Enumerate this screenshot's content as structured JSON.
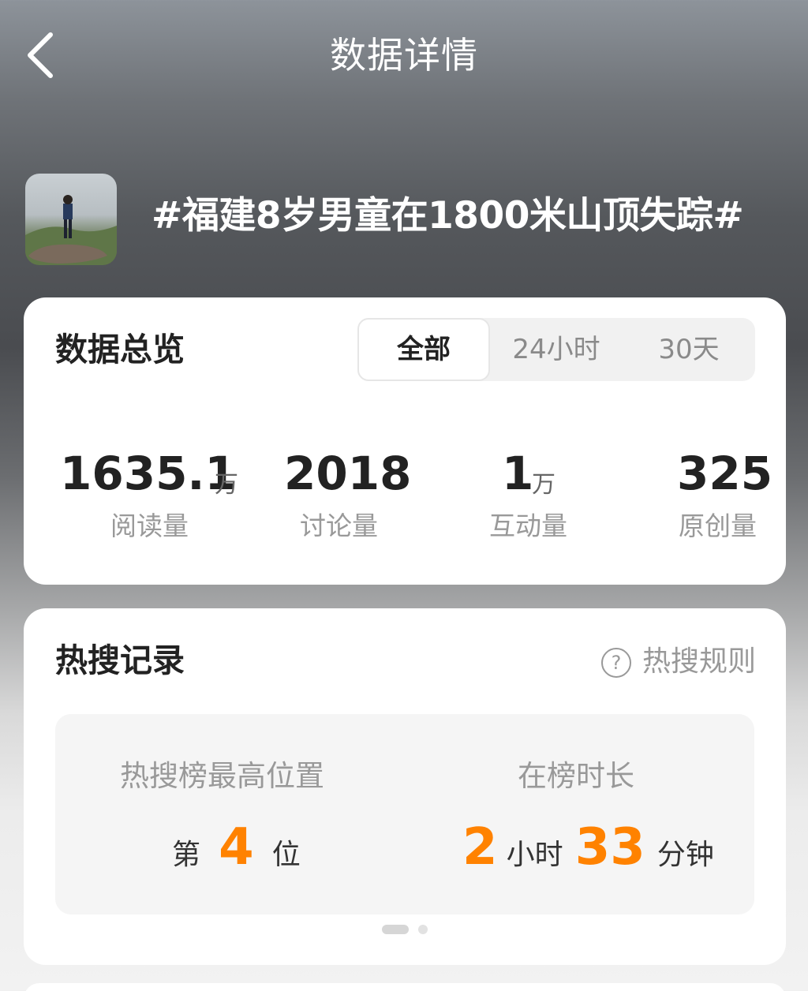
{
  "header": {
    "title": "数据详情"
  },
  "topic": {
    "title": "#福建8岁男童在1800米山顶失踪#"
  },
  "overview": {
    "heading": "数据总览",
    "tabs": [
      {
        "label": "全部",
        "active": true
      },
      {
        "label": "24小时",
        "active": false
      },
      {
        "label": "30天",
        "active": false
      }
    ],
    "stats": [
      {
        "value": "1635.1",
        "unit": "万",
        "label": "阅读量"
      },
      {
        "value": "2018",
        "unit": "",
        "label": "讨论量"
      },
      {
        "value": "1",
        "unit": "万",
        "label": "互动量"
      },
      {
        "value": "325",
        "unit": "",
        "label": "原创量"
      }
    ]
  },
  "hot_search": {
    "heading": "热搜记录",
    "rule_label": "热搜规则",
    "rule_icon": "question-circle-icon",
    "highest_position": {
      "label": "热搜榜最高位置",
      "prefix": "第",
      "value": "4",
      "suffix": "位"
    },
    "duration": {
      "label": "在榜时长",
      "hours": "2",
      "hours_unit": "小时",
      "minutes": "33",
      "minutes_unit": "分钟"
    },
    "pager": {
      "pages": 2,
      "current": 1
    }
  },
  "colors": {
    "accent": "#ff8200",
    "card": "#ffffff",
    "muted": "#999999"
  }
}
